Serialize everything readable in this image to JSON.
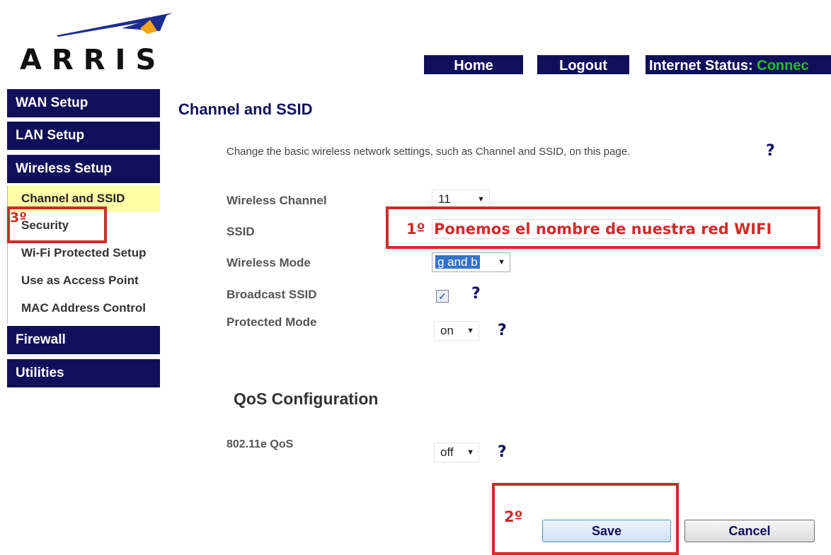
{
  "brand": {
    "logo_text": "ARRIS"
  },
  "topnav": {
    "home": "Home",
    "logout": "Logout",
    "status_label": "Internet Status:",
    "status_value": "Connec"
  },
  "sidebar": {
    "items": [
      {
        "label": "WAN Setup"
      },
      {
        "label": "LAN Setup"
      },
      {
        "label": "Wireless Setup"
      },
      {
        "label": "Firewall"
      },
      {
        "label": "Utilities"
      }
    ],
    "sub_items": [
      {
        "label": "Channel and SSID",
        "active": true
      },
      {
        "label": "Security"
      },
      {
        "label": "Wi-Fi Protected Setup"
      },
      {
        "label": "Use as Access Point"
      },
      {
        "label": "MAC Address Control"
      }
    ]
  },
  "main": {
    "title": "Channel and SSID",
    "intro": "Change the basic wireless network settings, such as Channel and SSID, on this page.",
    "help_symbol": "?",
    "fields": {
      "wireless_channel": {
        "label": "Wireless Channel",
        "value": "11"
      },
      "ssid": {
        "label": "SSID"
      },
      "wireless_mode": {
        "label": "Wireless Mode",
        "value": "g and b"
      },
      "broadcast_ssid": {
        "label": "Broadcast SSID",
        "checked": true
      },
      "protected_mode": {
        "label": "Protected Mode",
        "value": "on"
      }
    },
    "qos": {
      "title": "QoS Configuration",
      "label": "802.11e QoS",
      "value": "off"
    },
    "buttons": {
      "save": "Save",
      "cancel": "Cancel"
    }
  },
  "annotations": {
    "step1": "1º",
    "step1_text": "Ponemos el nombre de nuestra red WIFI",
    "step2": "2º",
    "step3": "3º"
  },
  "colors": {
    "nav_bg": "#10105a",
    "active_sub_bg": "#ffffa8",
    "status_green": "#1fbf1f",
    "annotation_red": "#d12a2a"
  }
}
